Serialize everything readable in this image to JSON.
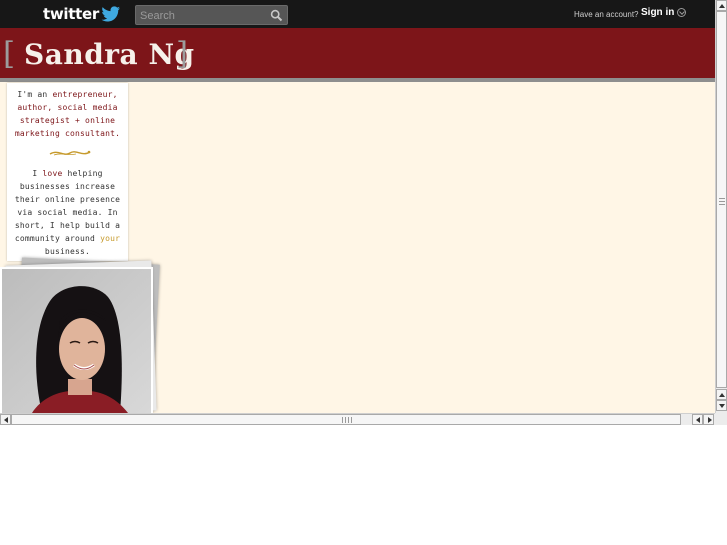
{
  "topbar": {
    "logo_text": "twitter",
    "search_placeholder": "Search",
    "have_account": "Have an account?",
    "sign_in": "Sign in",
    "icons": [
      "twitter-bird-icon",
      "search-icon",
      "chevron-down-icon"
    ]
  },
  "banner": {
    "bracket_left": "[",
    "name": "Sandra Ng",
    "bracket_right": "]"
  },
  "bio": {
    "p1_a": "I'm an ",
    "p1_b": "entrepreneur, author, social media strategist + online marketing consultant.",
    "p2_a": "I ",
    "p2_b": "love",
    "p2_c": " helping businesses increase their online presence via social media. In short, I help build a community around ",
    "p2_d": "your",
    "p2_e": " business."
  },
  "colors": {
    "topbar": "#171717",
    "banner": "#7d1519",
    "background": "#fff6e6",
    "accent_red": "#7d1519",
    "accent_gold": "#c69a2c"
  }
}
